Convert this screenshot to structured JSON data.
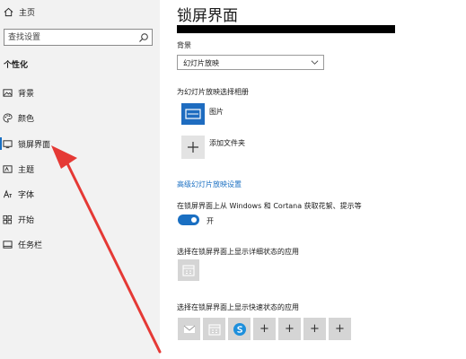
{
  "sidebar": {
    "home_label": "主页",
    "search_placeholder": "查找设置",
    "section_title": "个性化",
    "items": [
      {
        "label": "背景",
        "icon": "picture-icon"
      },
      {
        "label": "颜色",
        "icon": "palette-icon"
      },
      {
        "label": "锁屏界面",
        "icon": "lock-screen-icon",
        "active": true
      },
      {
        "label": "主题",
        "icon": "theme-icon"
      },
      {
        "label": "字体",
        "icon": "font-icon"
      },
      {
        "label": "开始",
        "icon": "start-icon"
      },
      {
        "label": "任务栏",
        "icon": "taskbar-icon"
      }
    ]
  },
  "main": {
    "title": "锁屏界面",
    "background_label": "背景",
    "background_value": "幻灯片放映",
    "album_prompt": "为幻灯片放映选择相册",
    "album_name": "图片",
    "add_folder_label": "添加文件夹",
    "advanced_link": "高级幻灯片放映设置",
    "fun_facts_label": "在锁屏界面上从 Windows 和 Cortana 获取花絮、提示等",
    "toggle_state": "开",
    "detailed_status_label": "选择在锁屏界面上显示详细状态的应用",
    "quick_status_label": "选择在锁屏界面上显示快速状态的应用",
    "quick_status_icons": [
      "mail-icon",
      "calendar-icon",
      "skype-icon",
      "plus-icon",
      "plus-icon",
      "plus-icon",
      "plus-icon"
    ],
    "plus_glyph": "+"
  },
  "colors": {
    "accent": "#1a6fc2",
    "sidebar_bg": "#f2f2f2",
    "arrow": "#e53935"
  }
}
